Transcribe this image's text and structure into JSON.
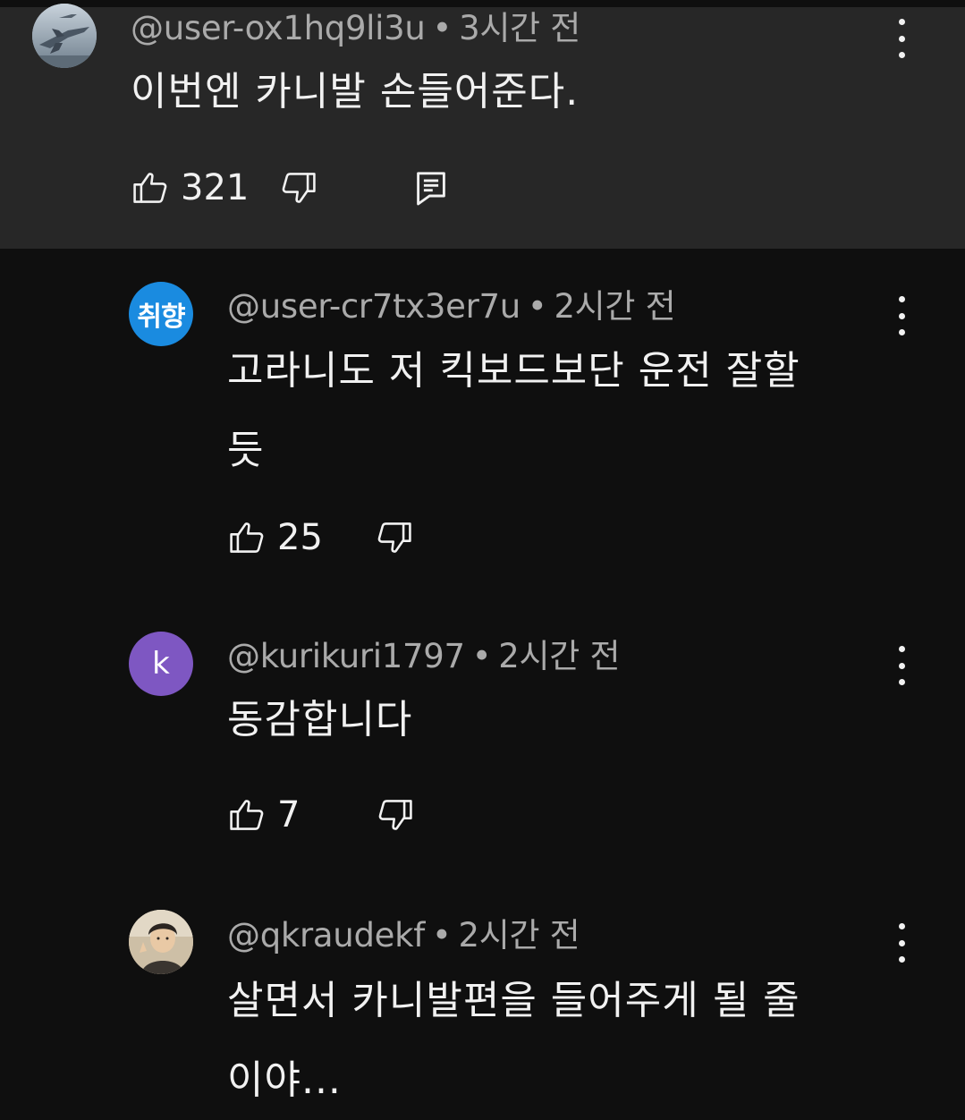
{
  "comments": [
    {
      "handle": "@user-ox1hq9li3u",
      "separator": "•",
      "time": "3시간 전",
      "text": "이번엔 카니발 손들어준다.",
      "likes": "321",
      "avatar_icon": "fighter-jet-photo-avatar"
    },
    {
      "handle": "@user-cr7tx3er7u",
      "separator": "•",
      "time": "2시간 전",
      "text": "고라니도 저 킥보드보단 운전 잘할\n듯",
      "likes": "25",
      "avatar_text": "취향",
      "avatar_color": "#1a8be0"
    },
    {
      "handle": "@kurikuri1797",
      "separator": "•",
      "time": "2시간 전",
      "text": "동감합니다",
      "likes": "7",
      "avatar_text": "k",
      "avatar_color": "#7e57c2"
    },
    {
      "handle": "@qkraudekf",
      "separator": "•",
      "time": "2시간 전",
      "text": "살면서 카니발편을 들어주게 될 줄\n이야...",
      "avatar_icon": "person-photo-avatar"
    }
  ],
  "colors": {
    "background": "#0f0f0f",
    "highlight_background": "#272727",
    "primary_text": "#f1f1f1",
    "secondary_text": "#aaaaaa"
  },
  "icons": {
    "like": "thumbs-up-icon",
    "dislike": "thumbs-down-icon",
    "reply": "reply-comment-icon",
    "more": "more-vertical-icon"
  }
}
